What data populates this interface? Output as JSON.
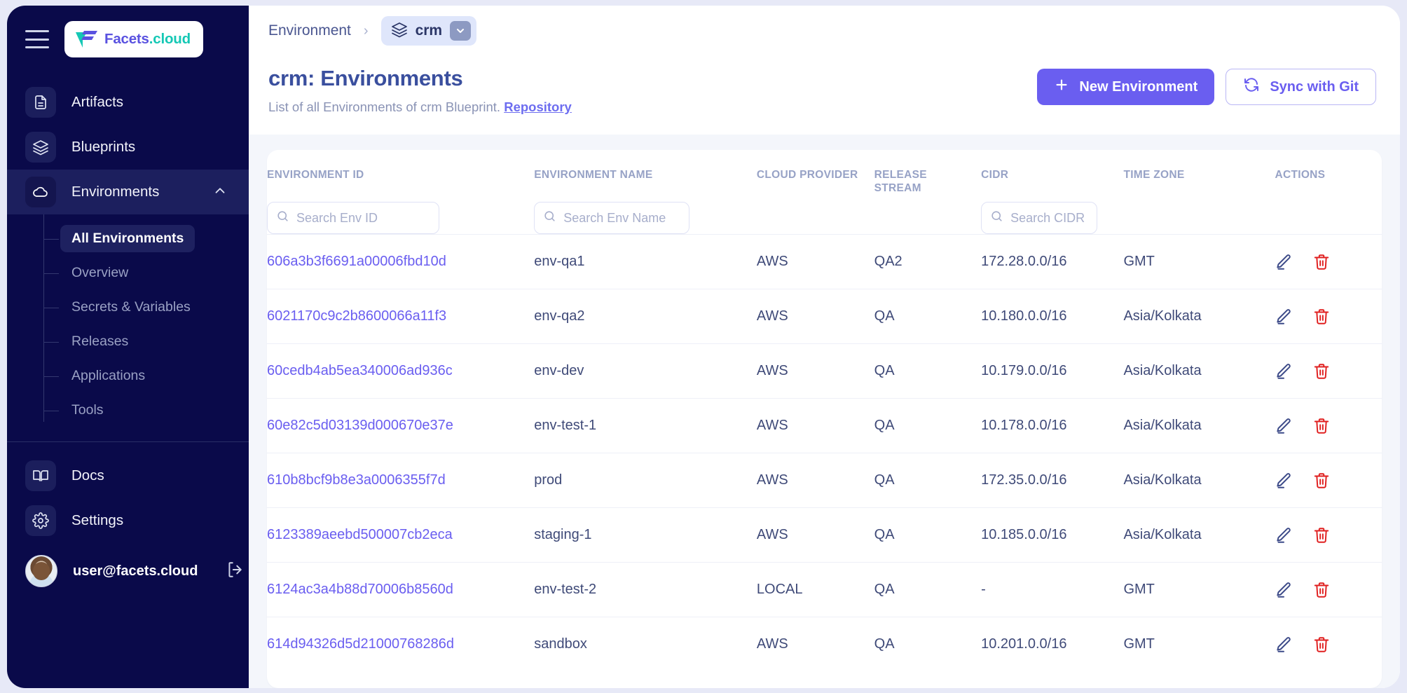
{
  "sidebar": {
    "logo": {
      "primary": "Facets",
      "suffix": ".cloud",
      "icon": "facets-logo-icon"
    },
    "hamburger_icon": "hamburger-menu-icon",
    "items": [
      {
        "label": "Artifacts",
        "icon": "document-icon"
      },
      {
        "label": "Blueprints",
        "icon": "layers-icon"
      },
      {
        "label": "Environments",
        "icon": "cloud-icon",
        "expanded": true,
        "chevron": "chevron-up-icon"
      }
    ],
    "sub_items": [
      {
        "label": "All Environments",
        "selected": true
      },
      {
        "label": "Overview",
        "selected": false
      },
      {
        "label": "Secrets & Variables",
        "selected": false
      },
      {
        "label": "Releases",
        "selected": false
      },
      {
        "label": "Applications",
        "selected": false
      },
      {
        "label": "Tools",
        "selected": false
      }
    ],
    "bottom_items": [
      {
        "label": "Docs",
        "icon": "book-icon"
      },
      {
        "label": "Settings",
        "icon": "gear-icon"
      }
    ],
    "user": {
      "email": "user@facets.cloud",
      "logout_icon": "logout-icon",
      "avatar": "user-avatar"
    }
  },
  "breadcrumb": {
    "root": "Environment",
    "separator": "›",
    "chip_label": "crm",
    "chip_icon": "layers-icon",
    "chip_caret_icon": "chevron-down-icon"
  },
  "page": {
    "title": "crm: Environments",
    "subtitle": "List of all Environments of crm Blueprint.",
    "subtitle_link": "Repository",
    "buttons": {
      "new_environment": {
        "label": "New Environment",
        "icon": "plus-icon",
        "color": "#6a5ef0"
      },
      "sync_with_git": {
        "label": "Sync with Git",
        "icon": "refresh-icon",
        "color": "#6a5ef0"
      }
    }
  },
  "table": {
    "columns": [
      {
        "key": "env_id",
        "label": "ENVIRONMENT ID",
        "search_placeholder": "Search Env ID"
      },
      {
        "key": "env_name",
        "label": "ENVIRONMENT NAME",
        "search_placeholder": "Search Env Name"
      },
      {
        "key": "cloud_provider",
        "label": "CLOUD PROVIDER"
      },
      {
        "key": "release_stream",
        "label": "RELEASE STREAM"
      },
      {
        "key": "cidr",
        "label": "CIDR",
        "search_placeholder": "Search CIDR"
      },
      {
        "key": "time_zone",
        "label": "TIME ZONE"
      },
      {
        "key": "actions",
        "label": "ACTIONS"
      }
    ],
    "search_icon": "search-icon",
    "row_actions": [
      {
        "name": "edit-icon",
        "color": "#3c4a88"
      },
      {
        "name": "delete-icon",
        "color": "#e02020"
      }
    ],
    "rows": [
      {
        "env_id": "606a3b3f6691a00006fbd10d",
        "env_name": "env-qa1",
        "cloud_provider": "AWS",
        "release_stream": "QA2",
        "cidr": "172.28.0.0/16",
        "time_zone": "GMT"
      },
      {
        "env_id": "6021170c9c2b8600066a11f3",
        "env_name": "env-qa2",
        "cloud_provider": "AWS",
        "release_stream": "QA",
        "cidr": "10.180.0.0/16",
        "time_zone": "Asia/Kolkata"
      },
      {
        "env_id": "60cedb4ab5ea340006ad936c",
        "env_name": "env-dev",
        "cloud_provider": "AWS",
        "release_stream": "QA",
        "cidr": "10.179.0.0/16",
        "time_zone": "Asia/Kolkata"
      },
      {
        "env_id": "60e82c5d03139d000670e37e",
        "env_name": "env-test-1",
        "cloud_provider": "AWS",
        "release_stream": "QA",
        "cidr": "10.178.0.0/16",
        "time_zone": "Asia/Kolkata"
      },
      {
        "env_id": "610b8bcf9b8e3a0006355f7d",
        "env_name": "prod",
        "cloud_provider": "AWS",
        "release_stream": "QA",
        "cidr": "172.35.0.0/16",
        "time_zone": "Asia/Kolkata"
      },
      {
        "env_id": "6123389aeebd500007cb2eca",
        "env_name": "staging-1",
        "cloud_provider": "AWS",
        "release_stream": "QA",
        "cidr": "10.185.0.0/16",
        "time_zone": "Asia/Kolkata"
      },
      {
        "env_id": "6124ac3a4b88d70006b8560d",
        "env_name": "env-test-2",
        "cloud_provider": "LOCAL",
        "release_stream": "QA",
        "cidr": "-",
        "time_zone": "GMT"
      },
      {
        "env_id": "614d94326d5d21000768286d",
        "env_name": "sandbox",
        "cloud_provider": "AWS",
        "release_stream": "QA",
        "cidr": "10.201.0.0/16",
        "time_zone": "GMT"
      }
    ]
  }
}
